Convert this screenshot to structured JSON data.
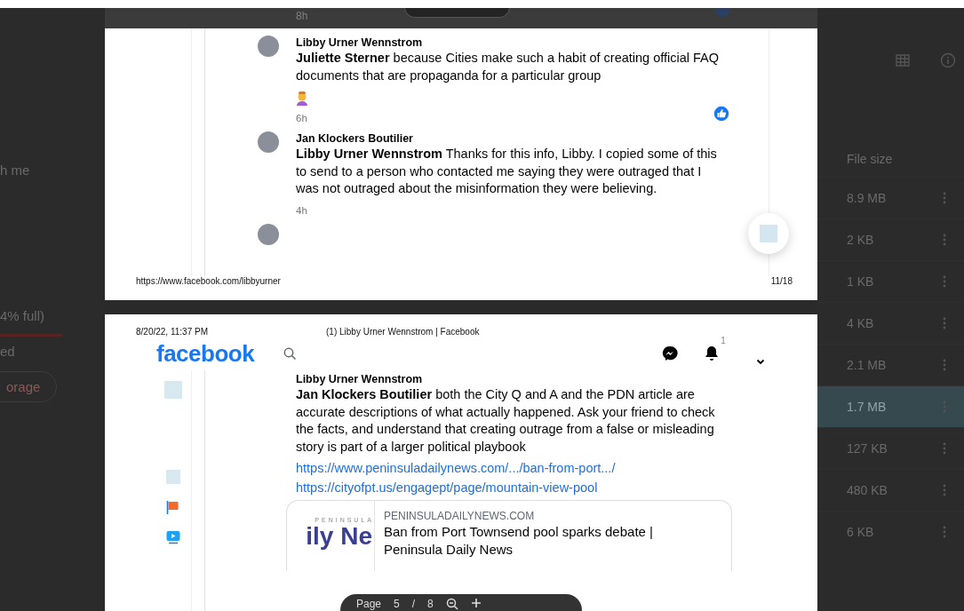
{
  "drive_left": {
    "nav_text": "h me",
    "storage_text": "4% full)",
    "storage_note": "ed",
    "storage_button": "orage"
  },
  "drive_right": {
    "column_header": "File size",
    "rows": [
      {
        "size": "8.9 MB",
        "selected": false
      },
      {
        "size": "2 KB",
        "selected": false
      },
      {
        "size": "1 KB",
        "selected": false
      },
      {
        "size": "4 KB",
        "selected": false
      },
      {
        "size": "2.1 MB",
        "selected": false
      },
      {
        "size": "1.7 MB",
        "selected": true
      },
      {
        "size": "127 KB",
        "selected": false
      },
      {
        "size": "480 KB",
        "selected": false
      },
      {
        "size": "6 KB",
        "selected": false
      }
    ]
  },
  "page_1": {
    "time_above": "8h",
    "comments": [
      {
        "author": "Libby Urner Wennstrom",
        "text": "**Juliette Sterner** because Cities make such a habit of creating official FAQ documents that are propaganda for a particular group",
        "emoji_reaction": true,
        "like_badge": true,
        "time": "6h"
      },
      {
        "author": "Jan Klockers Boutilier",
        "text": "**Libby Urner Wennstrom** Thanks for this info, Libby. I copied some of this to send to a person who contacted me saying they were outraged that I was not outraged about the misinformation they were believing.",
        "emoji_reaction": false,
        "like_badge": false,
        "time": "4h"
      }
    ],
    "footer_url": "https://www.facebook.com/libbyurner",
    "page_number": "11/18"
  },
  "page_2": {
    "date": "8/20/22, 11:37 PM",
    "title": "(1) Libby Urner Wennstrom | Facebook",
    "logo": "facebook",
    "notification_count": "1",
    "comment": {
      "author": "Libby Urner Wennstrom",
      "text": "**Jan Klockers Boutilier** both the City Q and A and the PDN article are accurate descriptions of what actually happened. Ask your friend to check the facts, and understand that creating outrage from a false or misleading story is part of a larger political playbook",
      "links": [
        "https://www.peninsuladailynews.com/.../ban-from-port.../",
        "https://cityofpt.us/engagept/page/mountain-view-pool"
      ]
    },
    "link_card": {
      "image_text": "ily Ne",
      "image_caption": "PENINSULA",
      "site": "PENINSULADAILYNEWS.COM",
      "title": "Ban from Port Townsend pool sparks debate |",
      "subtitle": "Peninsula Daily News"
    }
  },
  "page_toolbar": {
    "label": "Page",
    "current": "5",
    "separator": "/",
    "total": "8"
  }
}
